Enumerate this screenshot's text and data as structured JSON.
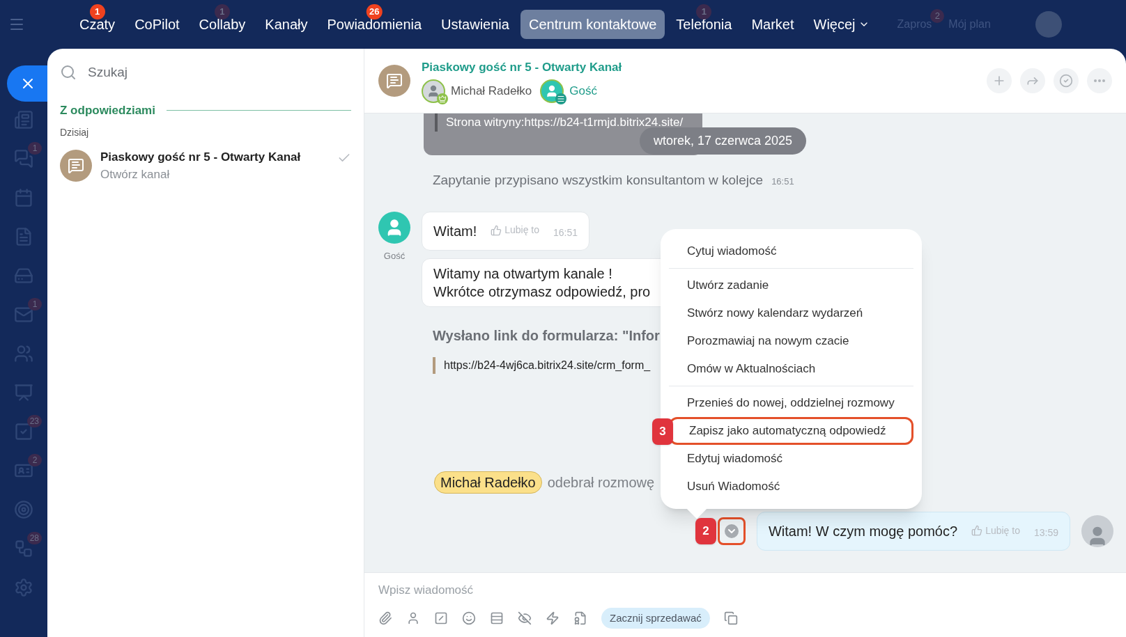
{
  "top_nav": {
    "items": [
      {
        "label": "Czaty",
        "selected": false,
        "badge": "1",
        "badge_muted": false
      },
      {
        "label": "CoPilot",
        "selected": false
      },
      {
        "label": "Collaby",
        "selected": false,
        "badge": "1",
        "badge_muted": true
      },
      {
        "label": "Kanały",
        "selected": false
      },
      {
        "label": "Powiadomienia",
        "selected": false,
        "badge": "26",
        "badge_muted": false
      },
      {
        "label": "Ustawienia",
        "selected": false
      },
      {
        "label": "Centrum kontaktowe",
        "selected": true
      },
      {
        "label": "Telefonia",
        "selected": false,
        "badge": "1",
        "badge_muted": true
      },
      {
        "label": "Market",
        "selected": false
      },
      {
        "label": "Więcej",
        "selected": false,
        "dropdown": true
      }
    ],
    "right": [
      {
        "label": "Zapros",
        "badge": "2"
      },
      {
        "label": "Mój plan"
      }
    ]
  },
  "rail": {
    "items": [
      {
        "kind": "news"
      },
      {
        "kind": "chats",
        "badge": "1"
      },
      {
        "kind": "calendar"
      },
      {
        "kind": "docs"
      },
      {
        "kind": "drive"
      },
      {
        "kind": "mail",
        "badge": "1"
      },
      {
        "kind": "contacts"
      },
      {
        "kind": "board"
      },
      {
        "kind": "tasks",
        "badge": "23"
      },
      {
        "kind": "crm",
        "badge": "2"
      },
      {
        "kind": "target"
      },
      {
        "kind": "flows",
        "badge": "28"
      },
      {
        "kind": "settings"
      }
    ]
  },
  "sidebar": {
    "search": {
      "placeholder": "Szukaj"
    },
    "section": "Z odpowiedziami",
    "group": "Dzisiaj",
    "items": [
      {
        "title": "Piaskowy gość nr 5 - Otwarty Kanał",
        "subtitle": "Otwórz kanał",
        "selected": false,
        "read": true
      }
    ]
  },
  "chat": {
    "title": "Piaskowy gość nr 5 - Otwarty Kanał",
    "participants": [
      {
        "name": "Michał Radełko",
        "kind": "operator"
      },
      {
        "name": "Gość",
        "kind": "guest"
      }
    ],
    "date_pill": "wtorek, 17 czerwca 2025",
    "messages": [
      {
        "kind": "quote-block",
        "text": "Strona witryny:https://b24-t1rmjd.bitrix24.site/"
      },
      {
        "kind": "system",
        "text": "Zapytanie przypisano wszystkim konsultantom w kolejce",
        "time": "16:51"
      },
      {
        "kind": "incoming",
        "author": "Gość",
        "text": "Witam!",
        "like": "Lubię to",
        "time": "16:51"
      },
      {
        "kind": "incoming-cont",
        "lines": [
          "Witamy na otwartym kanale !",
          "Wkrótce otrzymasz odpowiedź, pro"
        ]
      },
      {
        "kind": "form-link",
        "title": "Wysłano link do formularza: \"Infor",
        "link": "https://b24-4wj6ca.bitrix24.site/crm_form_"
      },
      {
        "kind": "transfer",
        "name": "Michał Radełko",
        "text": "odebrał rozmowę"
      },
      {
        "kind": "outgoing",
        "text": "Witam! W czym mogę pomóc?",
        "like": "Lubię to",
        "time": "13:59",
        "menu_button_highlighted": true,
        "marker": "2"
      }
    ],
    "context_menu": {
      "items": [
        {
          "label": "Cytuj wiadomość",
          "highlighted": false,
          "divider_after": true
        },
        {
          "label": "Utwórz zadanie",
          "highlighted": false,
          "divider_after": false
        },
        {
          "label": "Stwórz nowy kalendarz wydarzeń",
          "highlighted": false,
          "divider_after": false
        },
        {
          "label": "Porozmawiaj na nowym czacie",
          "highlighted": false,
          "divider_after": false
        },
        {
          "label": "Omów w Aktualnościach",
          "highlighted": false,
          "divider_after": true
        },
        {
          "label": "Przenieś do nowej, oddzielnej rozmowy",
          "highlighted": false,
          "divider_after": false
        },
        {
          "label": "Zapisz jako automatyczną odpowiedź",
          "highlighted": true,
          "marker": "3",
          "divider_after": false
        },
        {
          "label": "Edytuj wiadomość",
          "highlighted": false,
          "divider_after": false
        },
        {
          "label": "Usuń Wiadomość",
          "highlighted": false,
          "divider_after": false
        }
      ]
    },
    "composer": {
      "placeholder": "Wpisz wiadomość",
      "tools": [
        {
          "kind": "attach"
        },
        {
          "kind": "user"
        },
        {
          "kind": "command"
        },
        {
          "kind": "emoji"
        },
        {
          "kind": "list"
        },
        {
          "kind": "hidden"
        },
        {
          "kind": "quick"
        },
        {
          "kind": "file"
        },
        {
          "kind": "button",
          "label": "Zacznij sprzedawać"
        },
        {
          "kind": "windows"
        }
      ]
    }
  }
}
